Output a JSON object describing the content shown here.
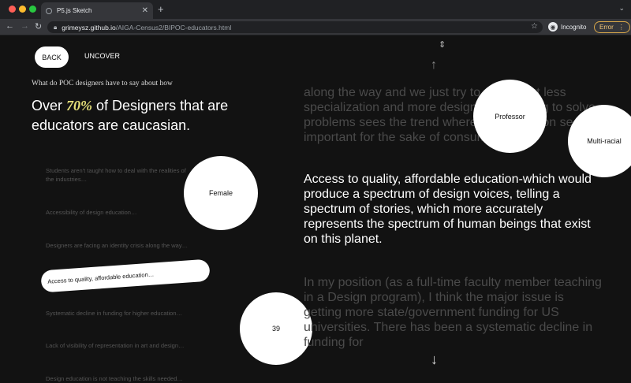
{
  "browser": {
    "tab_title": "P5.js Sketch",
    "url_host": "grimeysz.github.io",
    "url_path": "/AIGA-Census2/BIPOC-educators.html",
    "profile_label": "Incognito",
    "error_label": "Error"
  },
  "nav": {
    "back_label": "BACK",
    "uncover_label": "UNCOVER"
  },
  "hero": {
    "question": "What do POC designers have to say about how",
    "headline_pre": "Over ",
    "headline_pct": "70%",
    "headline_post": " of Designers that are educators are caucasian.",
    "accent_color": "#e6e07a"
  },
  "quotes": [
    {
      "text": "Students aren't taught how to deal with the realities of the industries…"
    },
    {
      "text": "Accessibility of design education…"
    },
    {
      "text": "Designers are facing an identity crisis along the way…"
    },
    {
      "text": "Access to quality, affordable education…"
    },
    {
      "text": "Systematic decline in funding for higher education…"
    },
    {
      "text": "Lack of visibility of representation in art and design…"
    },
    {
      "text": "Design education is not teaching the skills needed…"
    }
  ],
  "active_quote_index": 3,
  "circles": {
    "gender": "Female",
    "role": "Professor",
    "race": "Multi-racial",
    "age": "39"
  },
  "paragraphs": {
    "prev": "along the way and we just try to adapt, but less specialization and more design and thinking to solve problems sees the trend where specialization seems important for the sake of consumerism.",
    "current": "Access to quality, affordable education-which would produce a spectrum of design voices, telling a spectrum of stories, which more accurately represents the spectrum of human beings that exist on this planet.",
    "next": "In my position (as a full-time faculty member teaching in a Design program), I think the major issue is getting more state/government funding for US universities. There has been a systematic decline in funding for"
  }
}
